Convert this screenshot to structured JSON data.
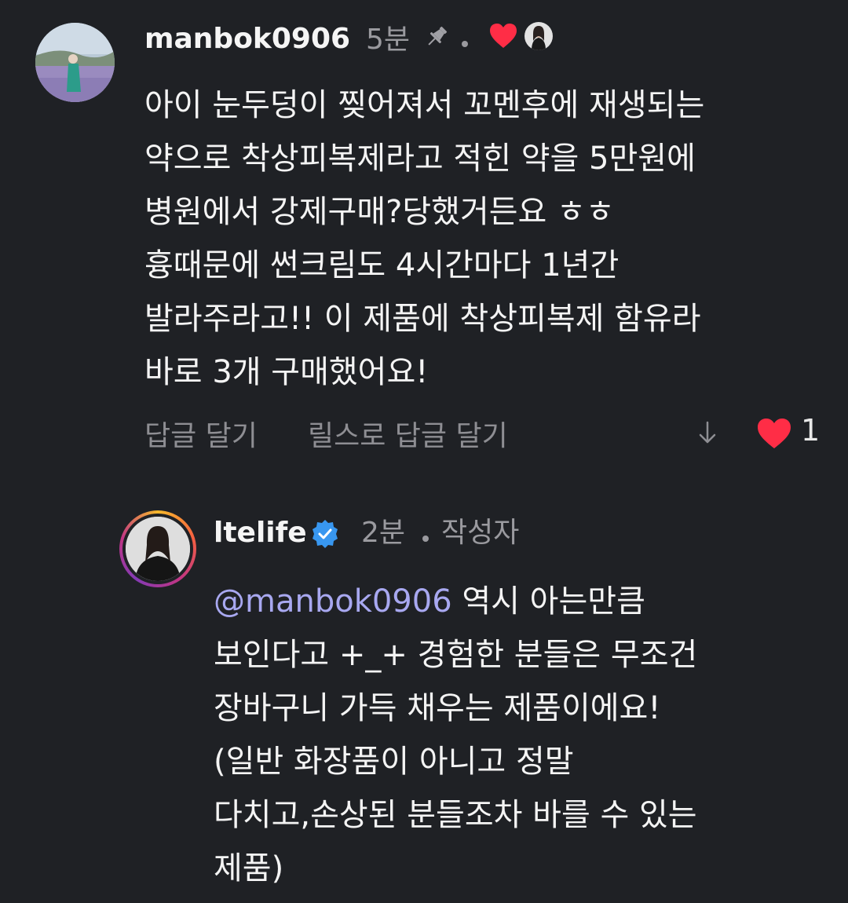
{
  "comments": [
    {
      "username": "manbok0906",
      "time": "5분",
      "text_lines": [
        "아이 눈두덩이 찢어져서 꼬멘후에 재생되는",
        "약으로 착상피복제라고 적힌 약을 5만원에",
        "병원에서 강제구매?당했거든요 ㅎㅎ",
        "흉때문에 썬크림도 4시간마다 1년간",
        "발라주라고!! 이 제품에 착상피복제 함유라",
        "바로 3개 구매했어요!"
      ],
      "actions": {
        "reply": "답글 달기",
        "reply_reels": "릴스로 답글 달기"
      },
      "like_count": "1",
      "colors": {
        "heart": "#ff2d46"
      }
    },
    {
      "username": "ltelife",
      "time": "2분",
      "author_label": "작성자",
      "mention": "@manbok0906",
      "text_first_line_rest": " 역시 아는만큼",
      "text_lines": [
        "보인다고 +_+ 경험한 분들은 무조건",
        "장바구니 가득 채우는 제품이에요!",
        "(일반 화장품이 아니고 정말",
        "다치고,손상된 분들조차 바를 수 있는",
        "제품)"
      ],
      "colors": {
        "verified": "#3897f0",
        "mention": "#a8a8f0"
      }
    }
  ]
}
